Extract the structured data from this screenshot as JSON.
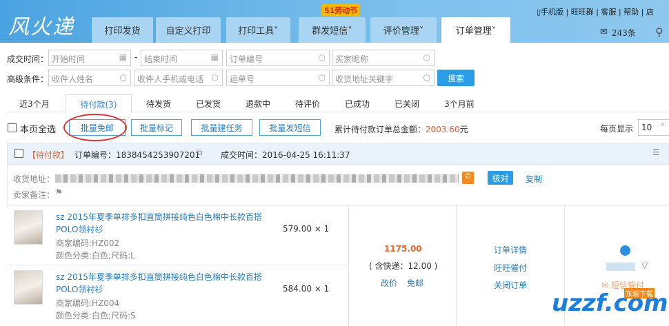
{
  "header": {
    "logo": "风火递",
    "promo": "51劳动节",
    "nav": [
      {
        "label": "打印发货"
      },
      {
        "label": "自定义打印"
      },
      {
        "label": "打印工具˅"
      },
      {
        "label": "群发短信˅"
      },
      {
        "label": "评价管理˅"
      },
      {
        "label": "订单管理˅"
      }
    ],
    "top_links": "▯手机版 | 旺旺群 | 客服 | 帮助 | 店",
    "messages": "243条"
  },
  "filters": {
    "deal_time_label": "成交时间：",
    "start_ph": "开始时间",
    "end_ph": "结束时间",
    "order_no_ph": "订单编号",
    "buyer_ph": "买家昵称",
    "advanced_label": "高级条件：",
    "receiver_ph": "收件人姓名",
    "phone_ph": "收件人手机或电话",
    "waybill_ph": "运单号",
    "address_ph": "收货地址关键字",
    "search": "搜索"
  },
  "status_tabs": [
    "近3个月",
    "待付款(3)",
    "待发货",
    "已发货",
    "退款中",
    "待评价",
    "已成功",
    "已关闭",
    "3个月前"
  ],
  "actions": {
    "select_all": "本页全选",
    "free_shipping": "批量免邮",
    "mark": "批量标记",
    "task": "批量建任务",
    "sms": "批量发短信",
    "total_label": "累计待付款订单总金额：",
    "total_value": "2003.60",
    "total_unit": "元",
    "per_page_label": "每页显示",
    "per_page": "10"
  },
  "order": {
    "status": "【待付款】",
    "order_no": "订单编号：1838454253907201",
    "deal_time": "成交时间：2016-04-25 16:11:37",
    "address_label": "收货地址：",
    "verify": "核对",
    "copy": "复制",
    "remark_label": "卖家备注：",
    "items": [
      {
        "title": "sz 2015年夏季单排多扣直筒拼接纯色白色棉中长款百搭POLO领衬衫",
        "sku": "商家编码:HZ002",
        "spec": "颜色分类:白色;尺码:L",
        "price": "579.00 × 1"
      },
      {
        "title": "sz 2015年夏季单排多扣直筒拼接纯色白色棉中长款百搭POLO领衬衫",
        "sku": "商家编码:HZ004",
        "spec": "颜色分类:白色;尺码:S",
        "price": "584.00 × 1"
      }
    ],
    "total": "1175.00",
    "shipping": "( 含快递：12.00 )",
    "change_price": "改价",
    "free_ship": "免邮",
    "detail": "订单详情",
    "wangwang": "旺旺催付",
    "close": "关闭订单",
    "sms_remind": "短信催付"
  },
  "watermark": "uzzf.com",
  "watermark_sub": "东坡下载"
}
